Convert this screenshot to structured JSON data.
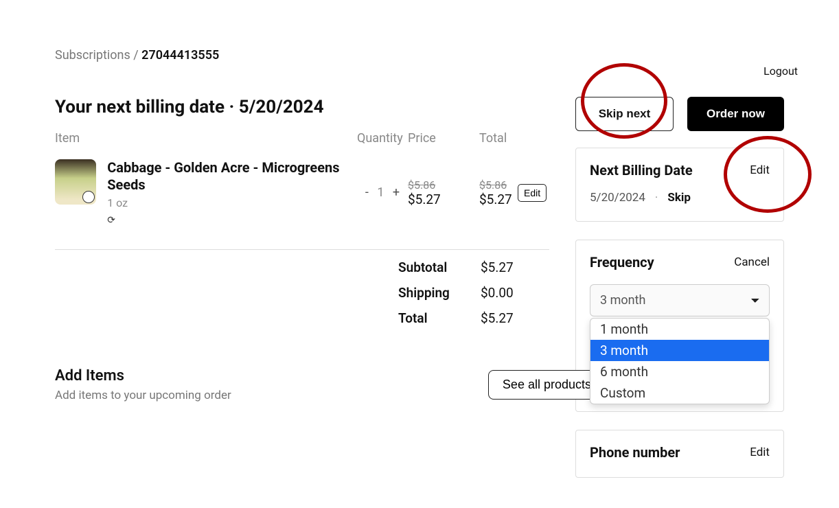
{
  "breadcrumb": {
    "root": "Subscriptions",
    "sep": "/",
    "current": "27044413555"
  },
  "logout": "Logout",
  "billing_heading": "Your next billing date · 5/20/2024",
  "table": {
    "item": "Item",
    "qty": "Quantity",
    "price": "Price",
    "total": "Total"
  },
  "item": {
    "title": "Cabbage - Golden Acre - Microgreens Seeds",
    "variant": "1 oz",
    "minus": "-",
    "qty": "1",
    "plus": "+",
    "price_strike": "$5.86",
    "price_now": "$5.27",
    "total_strike": "$5.86",
    "total_now": "$5.27",
    "edit": "Edit"
  },
  "totals": {
    "subtotal_lbl": "Subtotal",
    "subtotal_val": "$5.27",
    "shipping_lbl": "Shipping",
    "shipping_val": "$0.00",
    "total_lbl": "Total",
    "total_val": "$5.27"
  },
  "add_items": {
    "title": "Add Items",
    "desc": "Add items to your upcoming order",
    "see_all": "See all products"
  },
  "actions": {
    "skip_next": "Skip next",
    "order_now": "Order now"
  },
  "next_billing": {
    "title": "Next Billing Date",
    "edit": "Edit",
    "date": "5/20/2024",
    "skip": "Skip"
  },
  "frequency": {
    "title": "Frequency",
    "cancel": "Cancel",
    "selected": "3 month",
    "options": {
      "0": "1 month",
      "1": "3 month",
      "2": "6 month",
      "3": "Custom"
    }
  },
  "phone": {
    "title": "Phone number",
    "edit": "Edit"
  }
}
